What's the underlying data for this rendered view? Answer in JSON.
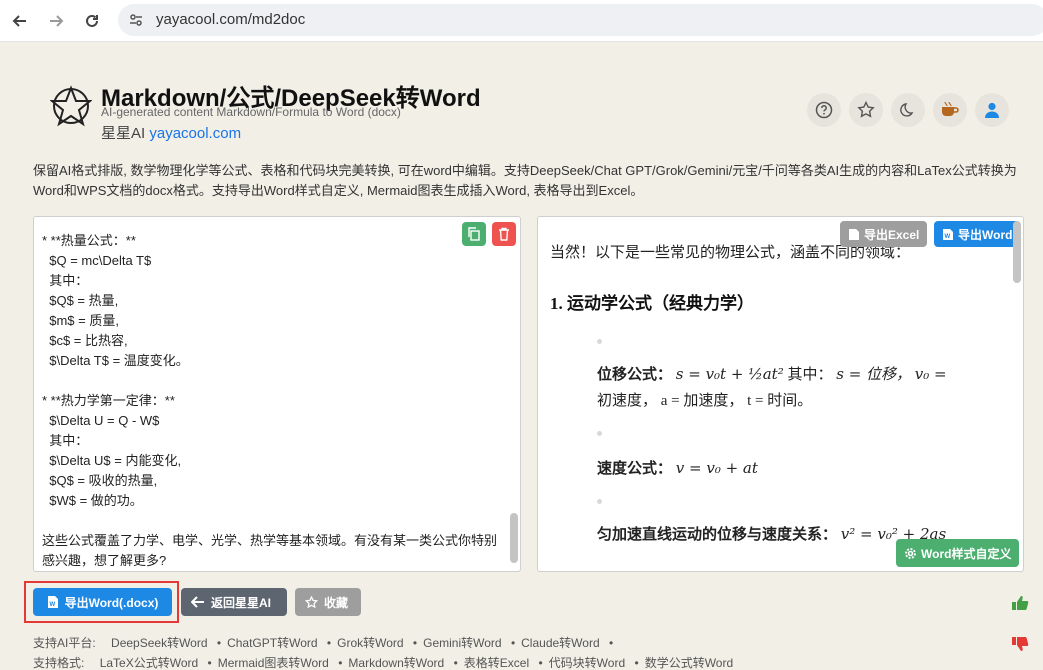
{
  "browser": {
    "url": "yayacool.com/md2doc"
  },
  "header": {
    "title": "Markdown/公式/DeepSeek转Word",
    "subtitle": "AI-generated content Markdown/Formula to Word (docx)",
    "brand_name": "星星AI",
    "brand_link": "yayacool.com"
  },
  "description": "保留AI格式排版, 数学物理化学等公式、表格和代码块完美转换, 可在word中编辑。支持DeepSeek/Chat GPT/Grok/Gemini/元宝/千问等各类AI生成的内容和LaTex公式转换为Word和WPS文档的docx格式。支持导出Word样式自定义, Mermaid图表生成插入Word, 表格导出到Excel。",
  "editor": {
    "content": "* **热量公式：**\n  $Q = mc\\Delta T$\n  其中：\n  $Q$ = 热量,\n  $m$ = 质量,\n  $c$ = 比热容,\n  $\\Delta T$ = 温度变化。\n\n* **热力学第一定律：**\n  $\\Delta U = Q - W$\n  其中：\n  $\\Delta U$ = 内能变化,\n  $Q$ = 吸收的热量,\n  $W$ = 做的功。\n\n这些公式覆盖了力学、电学、光学、热学等基本领域。有没有某一类公式你特别感兴趣，想了解更多?"
  },
  "preview": {
    "export_excel_label": "导出Excel",
    "export_word_label": "导出Word",
    "style_button_label": "Word样式自定义",
    "intro": "当然！以下是一些常见的物理公式，涵盖不同的领域：",
    "section_heading": "1.  运动学公式（经典力学）",
    "item1_label": "位移公式：",
    "item1_formula": "s = v₀t + ½at²",
    "item1_tail": "其中：",
    "item1_def1": "s = 位移，",
    "item1_def2": "v₀ =",
    "item1_line2": "初速度，  a = 加速度，  t = 时间。",
    "item2_label": "速度公式：",
    "item2_formula": "v = v₀ + at",
    "item3_label": "匀加速直线运动的位移与速度关系：",
    "item3_formula": "v² = v₀² + 2as"
  },
  "actions": {
    "export_word_docx": "导出Word(.docx)",
    "back_label": "返回星星AI",
    "favorite_label": "收藏"
  },
  "footer": {
    "platforms_label": "支持AI平台:",
    "platforms": [
      "DeepSeek转Word",
      "ChatGPT转Word",
      "Grok转Word",
      "Gemini转Word",
      "Claude转Word"
    ],
    "formats_label": "支持格式:",
    "formats": [
      "LaTeX公式转Word",
      "Mermaid图表转Word",
      "Markdown转Word",
      "表格转Excel",
      "代码块转Word",
      "数学公式转Word"
    ]
  },
  "colors": {
    "primary": "#1e88e5",
    "green": "#4caf70",
    "red": "#e53935",
    "background": "#f1efe6"
  }
}
